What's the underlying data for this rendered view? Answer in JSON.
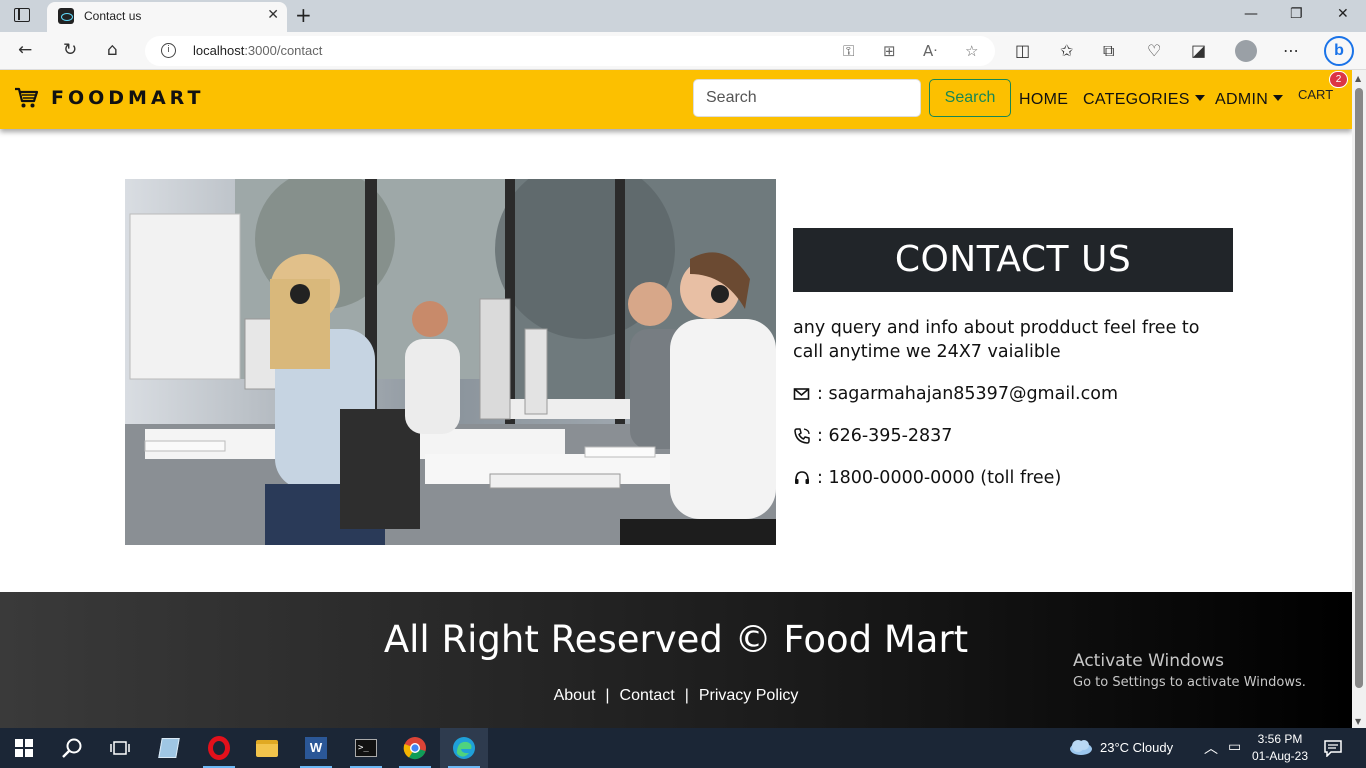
{
  "browser": {
    "tab_title": "Contact us",
    "url_host": "localhost",
    "url_path": ":3000/contact"
  },
  "navbar": {
    "brand": "FOODMART",
    "search_placeholder": "Search",
    "search_button": "Search",
    "links": {
      "home": "HOME",
      "categories": "CATEGORIES",
      "admin": "ADMIN",
      "cart": "CART"
    },
    "cart_count": "2",
    "accent_color": "#fcc000"
  },
  "contact": {
    "heading": "CONTACT US",
    "description": "any query and info about prodduct feel free to call anytime we 24X7 vaialible",
    "email": ": sagarmahajan85397@gmail.com",
    "phone": ": 626-395-2837",
    "tollfree": ": 1800-0000-0000 (toll free)",
    "icons": [
      "mail-icon",
      "phone-icon",
      "headset-icon"
    ]
  },
  "footer": {
    "title": "All Right Reserved © Food Mart",
    "links": [
      "About",
      "Contact",
      "Privacy Policy"
    ],
    "separator": "|"
  },
  "watermark": {
    "line1": "Activate Windows",
    "line2": "Go to Settings to activate Windows."
  },
  "taskbar": {
    "weather": "23°C  Cloudy",
    "time": "3:56 PM",
    "date": "01-Aug-23"
  }
}
